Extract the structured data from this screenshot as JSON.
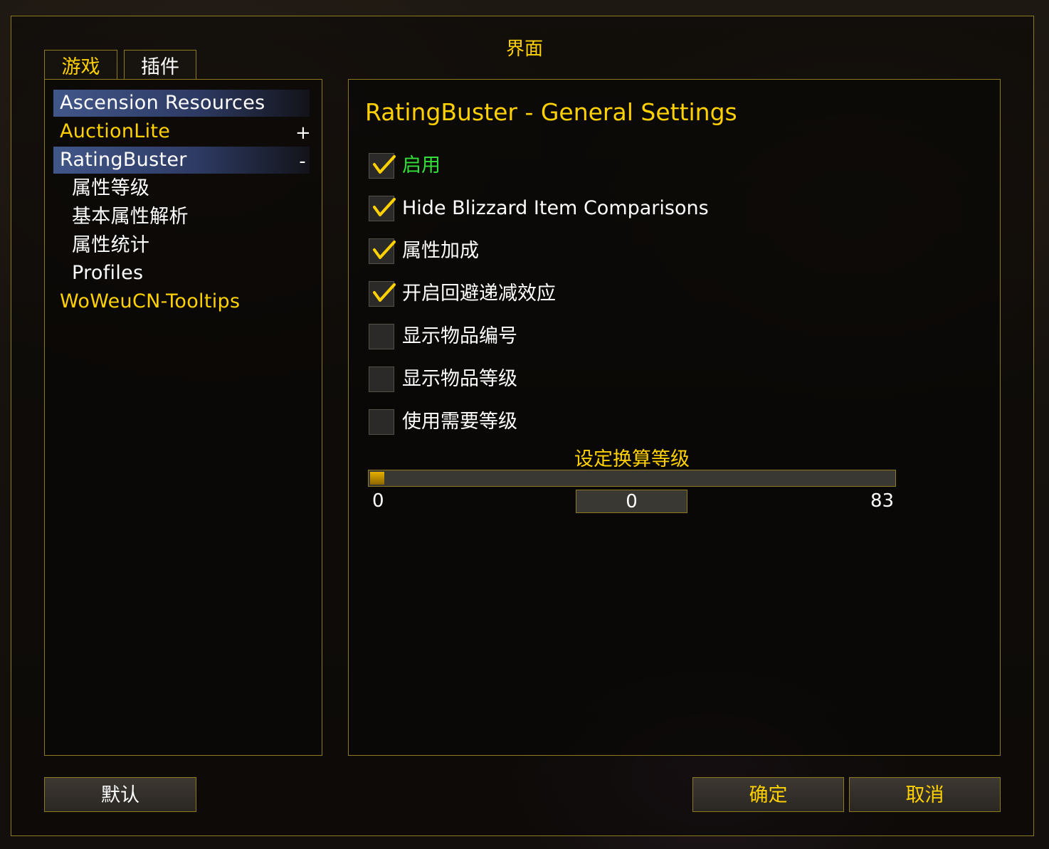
{
  "window": {
    "title": "界面"
  },
  "tabs": [
    {
      "label": "游戏",
      "active": true
    },
    {
      "label": "插件",
      "active": false
    }
  ],
  "nav": {
    "items": [
      {
        "label": "Ascension Resources",
        "color": "#ffffff",
        "toggle": ""
      },
      {
        "label": "AuctionLite",
        "color": "#ffd100",
        "toggle": "+"
      },
      {
        "label": "RatingBuster",
        "color": "#ffffff",
        "toggle": "-",
        "selected": true
      },
      {
        "label": "属性等级",
        "color": "#ffffff",
        "toggle": ""
      },
      {
        "label": "基本属性解析",
        "color": "#ffffff",
        "toggle": ""
      },
      {
        "label": "属性统计",
        "color": "#ffffff",
        "toggle": ""
      },
      {
        "label": "Profiles",
        "color": "#ffffff",
        "toggle": ""
      },
      {
        "label": "WoWeuCN-Tooltips",
        "color": "#ffd100",
        "toggle": ""
      }
    ]
  },
  "settings": {
    "title": "RatingBuster - General Settings",
    "checkboxes": [
      {
        "label": "启用",
        "checked": true,
        "color": "#33e03a"
      },
      {
        "label": "Hide Blizzard Item Comparisons",
        "checked": true,
        "color": "#ffffff"
      },
      {
        "label": "属性加成",
        "checked": true,
        "color": "#ffffff"
      },
      {
        "label": "开启回避递减效应",
        "checked": true,
        "color": "#ffffff"
      },
      {
        "label": "显示物品编号",
        "checked": false,
        "color": "#ffffff"
      },
      {
        "label": "显示物品等级",
        "checked": false,
        "color": "#ffffff"
      },
      {
        "label": "使用需要等级",
        "checked": false,
        "color": "#ffffff"
      }
    ],
    "slider": {
      "label": "设定换算等级",
      "min": "0",
      "max": "83",
      "value": "0"
    }
  },
  "buttons": {
    "default": "默认",
    "ok": "确定",
    "cancel": "取消"
  },
  "colors": {
    "gold": "#ffd100",
    "border": "#8e7a1e",
    "check": "#ffd100"
  }
}
